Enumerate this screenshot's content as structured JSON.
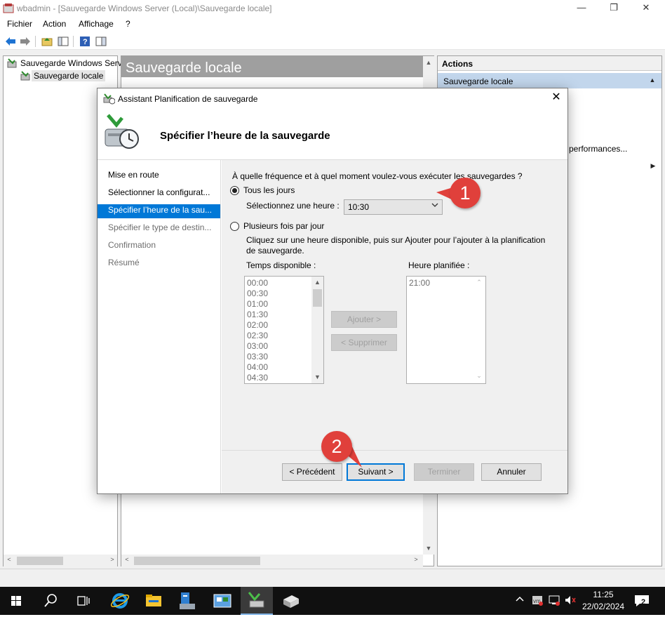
{
  "window": {
    "title": "wbadmin - [Sauvegarde Windows Server (Local)\\Sauvegarde locale]",
    "minimize_glyph": "—",
    "restore_glyph": "❐",
    "close_glyph": "✕"
  },
  "menu": {
    "items": [
      "Fichier",
      "Action",
      "Affichage",
      "?"
    ]
  },
  "tree": {
    "root": "Sauvegarde Windows Serv",
    "child": "Sauvegarde locale"
  },
  "center": {
    "header": "Sauvegarde locale"
  },
  "actions": {
    "title": "Actions",
    "subtitle": "Sauvegarde locale",
    "partial_item": "performances..."
  },
  "dialog": {
    "title": "Assistant Planification de sauvegarde",
    "close_glyph": "✕",
    "heading": "Spécifier l’heure de la sauvegarde",
    "steps": [
      {
        "label": "Mise en route",
        "state": "done"
      },
      {
        "label": "Sélectionner la configurat...",
        "state": "done"
      },
      {
        "label": "Spécifier l’heure de la sau...",
        "state": "active"
      },
      {
        "label": "Spécifier le type de destin...",
        "state": "pending"
      },
      {
        "label": "Confirmation",
        "state": "pending"
      },
      {
        "label": "Résumé",
        "state": "pending"
      }
    ],
    "question": "À quelle fréquence et à quel moment voulez-vous exécuter les sauvegardes ?",
    "once_label": "Tous les jours",
    "select_time_label": "Sélectionnez une heure :",
    "select_time_value": "10:30",
    "multiple_label": "Plusieurs fois par jour",
    "multiple_help_line1": "Cliquez sur une heure disponible, puis sur Ajouter pour l’ajouter à la planification",
    "multiple_help_line2": "de sauvegarde.",
    "available_label": "Temps disponible :",
    "available_times": [
      "00:00",
      "00:30",
      "01:00",
      "01:30",
      "02:00",
      "02:30",
      "03:00",
      "03:30",
      "04:00",
      "04:30"
    ],
    "scheduled_label": "Heure planifiée :",
    "scheduled_times": [
      "21:00"
    ],
    "add_button": "Ajouter >",
    "remove_button": "< Supprimer",
    "prev_button": "< Précédent",
    "next_button": "Suivant >",
    "finish_button": "Terminer",
    "cancel_button": "Annuler"
  },
  "callouts": {
    "one": "1",
    "two": "2"
  },
  "taskbar": {
    "time": "11:25",
    "date": "22/02/2024",
    "notification_count": "2"
  },
  "colors": {
    "accent": "#0078d7",
    "callout": "#e0403b",
    "taskbar": "#101010",
    "header_gray": "#9f9f9f"
  }
}
